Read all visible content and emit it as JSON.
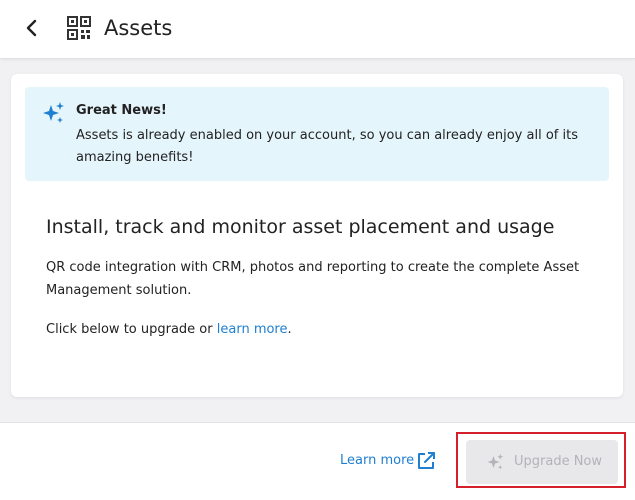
{
  "header": {
    "title": "Assets",
    "back_icon": "chevron-left-icon",
    "app_icon": "qr-code-icon"
  },
  "banner": {
    "icon": "sparkle-icon",
    "title": "Great News!",
    "message": "Assets is already enabled on your account, so you can already enjoy all of its amazing benefits!",
    "background_color": "#e5f5fc",
    "accent_color": "#1f7fd0"
  },
  "content": {
    "heading": "Install, track and monitor asset placement and usage",
    "description": "QR code integration with CRM, photos and reporting to create the complete Asset Management solution.",
    "cta_prefix": "Click below to upgrade or ",
    "cta_link": "learn more",
    "cta_suffix": "."
  },
  "footer": {
    "learn_more_label": "Learn more",
    "learn_more_icon": "external-link-icon",
    "upgrade_label": "Upgrade Now",
    "upgrade_icon": "sparkle-icon",
    "upgrade_disabled": true,
    "highlight_color": "#d4202a"
  }
}
